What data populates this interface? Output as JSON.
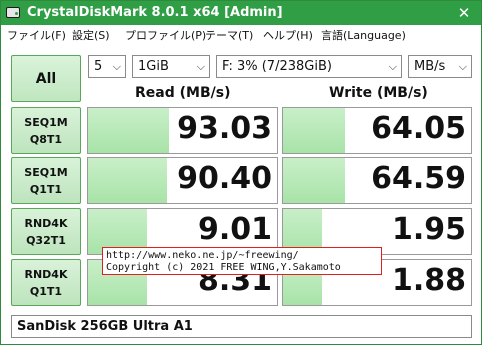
{
  "window": {
    "title": "CrystalDiskMark 8.0.1 x64 [Admin]",
    "close_glyph": "✕"
  },
  "menu": [
    "ファイル(F)",
    "設定(S)",
    "プロファイル(P)",
    "テーマ(T)",
    "ヘルプ(H)",
    "言語(Language)"
  ],
  "controls": {
    "all_label": "All",
    "count": "5",
    "size": "1GiB",
    "drive": "F: 3% (7/238GiB)",
    "unit": "MB/s",
    "chevron": "⌵"
  },
  "columns": {
    "read": "Read (MB/s)",
    "write": "Write (MB/s)"
  },
  "tests": [
    {
      "line1": "SEQ1M",
      "line2": "Q8T1",
      "read": "93.03",
      "write": "64.05",
      "read_fill": 0.43,
      "write_fill": 0.33
    },
    {
      "line1": "SEQ1M",
      "line2": "Q1T1",
      "read": "90.40",
      "write": "64.59",
      "read_fill": 0.42,
      "write_fill": 0.33
    },
    {
      "line1": "RND4K",
      "line2": "Q32T1",
      "read": "9.01",
      "write": "1.95",
      "read_fill": 0.31,
      "write_fill": 0.21
    },
    {
      "line1": "RND4K",
      "line2": "Q1T1",
      "read": "8.31",
      "write": "1.88",
      "read_fill": 0.31,
      "write_fill": 0.21
    }
  ],
  "status": "SanDisk 256GB Ultra A1",
  "watermark": {
    "line1": "http://www.neko.ne.jp/~freewing/",
    "line2": "Copyright (c) 2021 FREE WING,Y.Sakamoto"
  }
}
